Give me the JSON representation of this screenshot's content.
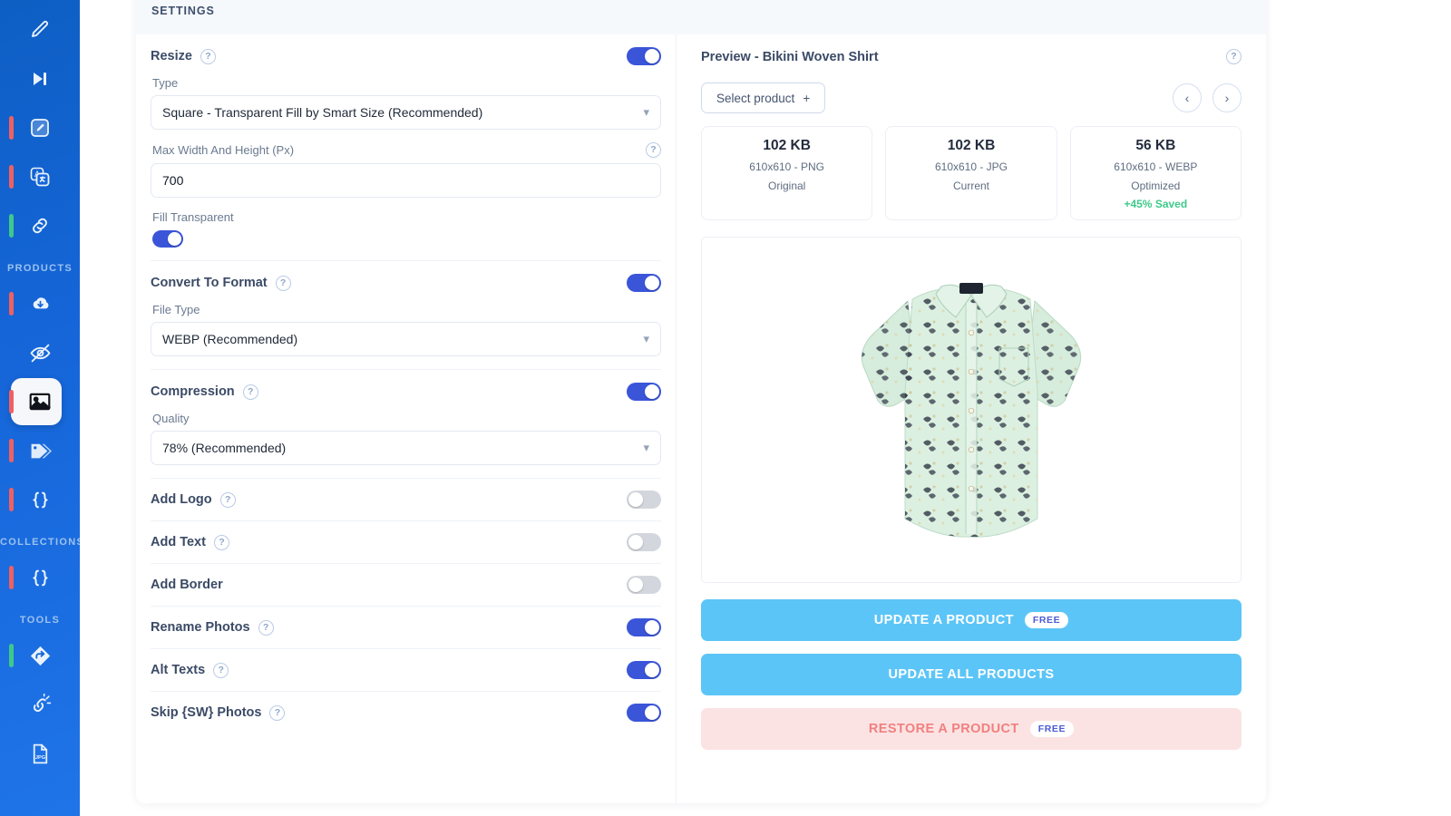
{
  "sidebar": {
    "groups": [
      {
        "label": "",
        "items": [
          {
            "icon": "pencil-icon",
            "bar": "none",
            "active": false
          },
          {
            "icon": "skip-forward-icon",
            "bar": "none",
            "active": false
          },
          {
            "icon": "edit-box-icon",
            "bar": "red",
            "active": false
          },
          {
            "icon": "translate-icon",
            "bar": "red",
            "active": false
          },
          {
            "icon": "link-icon",
            "bar": "green",
            "active": false
          }
        ]
      },
      {
        "label": "PRODUCTS",
        "items": [
          {
            "icon": "cloud-download-icon",
            "bar": "red",
            "active": false
          },
          {
            "icon": "eye-off-icon",
            "bar": "none",
            "active": false
          },
          {
            "icon": "image-icon",
            "bar": "red",
            "active": true
          },
          {
            "icon": "tags-icon",
            "bar": "red",
            "active": false
          },
          {
            "icon": "braces-icon",
            "bar": "red",
            "active": false
          }
        ]
      },
      {
        "label": "COLLECTIONS",
        "items": [
          {
            "icon": "braces-icon",
            "bar": "red",
            "active": false
          }
        ]
      },
      {
        "label": "TOOLS",
        "items": [
          {
            "icon": "redirect-icon",
            "bar": "green",
            "active": false
          },
          {
            "icon": "broken-link-icon",
            "bar": "none",
            "active": false
          },
          {
            "icon": "jpg-file-icon",
            "bar": "none",
            "active": false
          }
        ]
      }
    ]
  },
  "card": {
    "header_title": "SETTINGS"
  },
  "settings": {
    "resize": {
      "label": "Resize",
      "help": "?",
      "enabled": true,
      "type_label": "Type",
      "type_value": "Square - Transparent Fill by Smart Size (Recommended)",
      "max_label": "Max Width And Height (Px)",
      "max_help": "?",
      "max_value": "700",
      "fill_label": "Fill Transparent",
      "fill_enabled": true
    },
    "convert": {
      "label": "Convert To Format",
      "help": "?",
      "enabled": true,
      "file_type_label": "File Type",
      "file_type_value": "WEBP (Recommended)"
    },
    "compression": {
      "label": "Compression",
      "help": "?",
      "enabled": true,
      "quality_label": "Quality",
      "quality_value": "78% (Recommended)"
    },
    "toggles": [
      {
        "label": "Add Logo",
        "help": "?",
        "enabled": false
      },
      {
        "label": "Add Text",
        "help": "?",
        "enabled": false
      },
      {
        "label": "Add Border",
        "help": "",
        "enabled": false
      },
      {
        "label": "Rename Photos",
        "help": "?",
        "enabled": true
      },
      {
        "label": "Alt Texts",
        "help": "?",
        "enabled": true
      },
      {
        "label": "Skip {SW} Photos",
        "help": "?",
        "enabled": true
      }
    ]
  },
  "preview": {
    "title": "Preview - Bikini Woven Shirt",
    "help": "?",
    "select_product_label": "Select product",
    "select_product_plus": "+",
    "prev_arrow": "‹",
    "next_arrow": "›",
    "stats": [
      {
        "size": "102 KB",
        "dims": "610x610 - PNG",
        "kind": "Original",
        "saved": ""
      },
      {
        "size": "102 KB",
        "dims": "610x610 - JPG",
        "kind": "Current",
        "saved": ""
      },
      {
        "size": "56 KB",
        "dims": "610x610 - WEBP",
        "kind": "Optimized",
        "saved": "+45% Saved"
      }
    ],
    "image_alt": "Mint green patterned short sleeve button-up shirt",
    "actions": [
      {
        "label": "UPDATE A PRODUCT",
        "badge": "FREE",
        "style": "primary"
      },
      {
        "label": "UPDATE ALL PRODUCTS",
        "badge": "",
        "style": "primary"
      },
      {
        "label": "RESTORE A PRODUCT",
        "badge": "FREE",
        "style": "danger"
      }
    ]
  },
  "colors": {
    "sidebar_blue": "#1565d8",
    "toggle_on": "#3b55d9",
    "primary_button": "#5cc5f7",
    "danger_button_bg": "#fce3e3",
    "danger_button_text": "#f08080",
    "saved_green": "#3ec98a",
    "badge_text": "#4b5bd6"
  }
}
